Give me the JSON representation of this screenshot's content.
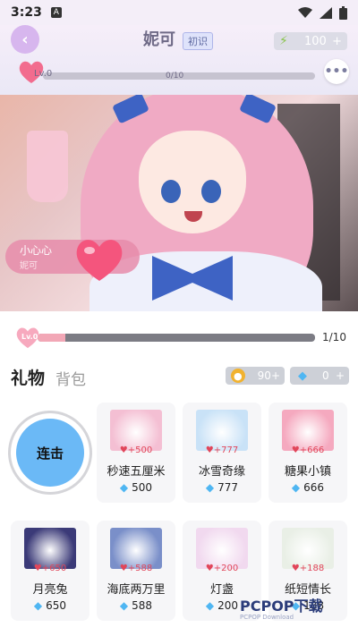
{
  "status": {
    "time": "3:23",
    "notif": "A"
  },
  "header": {
    "name": "妮可",
    "relation": "初识",
    "energy": "100",
    "energy_plus": "+",
    "level": "Lv.0",
    "progress": "0/10"
  },
  "mood": {
    "title": "小心心",
    "sub": "妮可"
  },
  "level_bar": {
    "label": "Lv.0",
    "value": "1/10",
    "fill_fraction": 0.1
  },
  "tabs": {
    "gift": "礼物",
    "bag": "背包"
  },
  "currency": {
    "gold": "90",
    "gold_plus": "+",
    "diamond": "0",
    "diamond_plus": "+"
  },
  "combo_label": "连击",
  "gifts": [
    {
      "name": "秒速五厘米",
      "charm": "+500",
      "price": "500",
      "color": "#f4bfd3",
      "icon": "sakura-tree-icon"
    },
    {
      "name": "冰雪奇缘",
      "charm": "+777",
      "price": "777",
      "color": "#c9e2f7",
      "icon": "ice-castle-icon"
    },
    {
      "name": "糖果小镇",
      "charm": "+666",
      "price": "666",
      "color": "#f5a9bf",
      "icon": "candy-town-icon"
    },
    {
      "name": "月亮兔",
      "charm": "+650",
      "price": "650",
      "color": "#3b3a78",
      "icon": "moon-rabbit-icon"
    },
    {
      "name": "海底两万里",
      "charm": "+588",
      "price": "588",
      "color": "#7a8fc9",
      "icon": "underwater-bubbles-icon"
    },
    {
      "name": "灯盏",
      "charm": "+200",
      "price": "200",
      "color": "#f1d9ef",
      "icon": "lantern-icon"
    },
    {
      "name": "纸短情长",
      "charm": "+188",
      "price": "188",
      "color": "#e9efe6",
      "icon": "flower-bouquet-icon"
    }
  ],
  "watermark": {
    "brand": "PCPOP下载",
    "sub": "PCPOP Download"
  },
  "colors": {
    "accent": "#f2a7b6",
    "combo": "#6bb9f6",
    "diamond": "#4fb6f2"
  }
}
